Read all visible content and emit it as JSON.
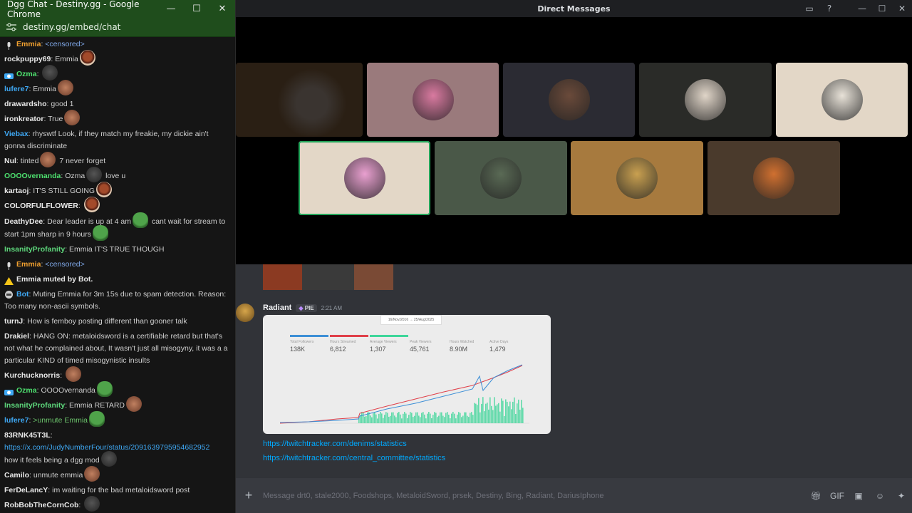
{
  "chat_window": {
    "title": "Dgg Chat - Destiny.gg - Google Chrome",
    "url": "destiny.gg/embed/chat",
    "controls": {
      "minimize": "—",
      "maximize": "☐",
      "close": "✕"
    }
  },
  "chat": [
    {
      "user": "Emmia",
      "style": "orange",
      "badge": "mic",
      "text": "<censored>",
      "censored": true
    },
    {
      "user": "rockpuppy69",
      "text": "Emmia",
      "emote": "face"
    },
    {
      "user": "Ozma",
      "style": "green",
      "badge": "bear",
      "text": "",
      "emote": "dark"
    },
    {
      "user": "lufere7",
      "style": "blue",
      "text": "Emmia",
      "emote": "brown"
    },
    {
      "user": "drawardsho",
      "text": "good 1"
    },
    {
      "user": "ironkreator",
      "text": "True",
      "emote": "brown"
    },
    {
      "user": "Viebax",
      "style": "blue",
      "text": "rhyswtf Look, if they match my freakie, my dickie ain't gonna discriminate",
      "wrap": true
    },
    {
      "user": "Nul",
      "text": "tinted",
      "emote": "brown",
      "text2": "7 never forget"
    },
    {
      "user": "OOOOvernanda",
      "style": "green",
      "text": "Ozma",
      "emote": "dark",
      "text2": "love u"
    },
    {
      "user": "kartaoj",
      "text": "IT'S STILL GOING",
      "emote": "face"
    },
    {
      "user": "COLORFULFLOWER",
      "text": "",
      "emote": "face"
    },
    {
      "user": "DeathyDee",
      "text": "Dear leader is up at 4 am",
      "emote": "pepe",
      "text2": "cant wait for stream to start 1pm sharp in 9 hours",
      "emote2": "pepe",
      "wrap": true
    },
    {
      "user": "InsanityProfanity",
      "style": "lime",
      "text": "Emmia IT'S TRUE THOUGH"
    },
    {
      "user": "Emmia",
      "style": "orange",
      "badge": "mic",
      "text": "<censored>",
      "censored": true
    },
    {
      "user": "",
      "badge": "warn",
      "text": "Emmia muted by Bot.",
      "bold": true
    },
    {
      "user": "Bot",
      "style": "blue",
      "badge": "bot",
      "text": "Muting Emmia for 3m 15s due to spam detection. Reason: Too many non-ascii symbols.",
      "wrap": true
    },
    {
      "user": "turnJ",
      "text": "How is femboy posting different than gooner talk"
    },
    {
      "user": "Drakiel",
      "text": "HANG ON: metaloidsword is a certifiable retard but that's not what he complained about, It wasn't just all misogyny, it was a a particular KIND of timed misogynistic insults",
      "wrap": true
    },
    {
      "user": "Kurchucknorris",
      "text": "",
      "emote": "brown"
    },
    {
      "user": "Ozma",
      "style": "green",
      "badge": "bear",
      "text": "OOOOvernanda",
      "emote": "pepe"
    },
    {
      "user": "InsanityProfanity",
      "style": "lime",
      "text": "Emmia RETARD",
      "emote": "brown"
    },
    {
      "user": "lufere7",
      "style": "blue",
      "text": ">unmute Emmia",
      "greentext": true,
      "emote": "pepe"
    },
    {
      "user": "83RNK45T3L",
      "text": "",
      "link": "https://x.com/JudyNumberFour/status/2091639795954682952",
      "text2": "how it feels being a dgg mod",
      "emote2": "dark",
      "wrap": true
    },
    {
      "user": "Camilo",
      "text": "unmute emmia",
      "emote": "brown"
    },
    {
      "user": "FerDeLancY",
      "text": "im waiting for the bad metaloidsword post"
    },
    {
      "user": "RobBobTheCornCob",
      "text": "",
      "emote": "dark"
    }
  ],
  "discord": {
    "title": "Direct Messages",
    "call_tiles": [
      {
        "kind": "video",
        "bg": "#2a1f14"
      },
      {
        "kind": "avatar",
        "bg": "#9a7a7c",
        "av": "#d97aa0"
      },
      {
        "kind": "avatar",
        "bg": "#2b2b33",
        "av": "#6a4a3a"
      },
      {
        "kind": "avatar",
        "bg": "#2a2b28",
        "av": "#e0d5c8"
      },
      {
        "kind": "avatar",
        "bg": "#e3d7c7",
        "av": "#e8e2d8"
      },
      {
        "kind": "avatar",
        "bg": "#e3d7c7",
        "av": "#e9a0d0",
        "speaking": true
      },
      {
        "kind": "avatar",
        "bg": "#4a5848",
        "av": "#5a6a55"
      },
      {
        "kind": "avatar",
        "bg": "#a77a3e",
        "av": "#c9a050"
      },
      {
        "kind": "avatar",
        "bg": "#4a3a2c",
        "av": "#d07030"
      }
    ],
    "message": {
      "author": "Radiant",
      "tag": "PIE",
      "time": "2:21 AM",
      "links": [
        "https://twitchtracker.com/denims/statistics",
        "https://twitchtracker.com/central_committee/statistics"
      ]
    },
    "embed_stats": {
      "daterange": "16/Nov/2016 → 25/Aug/2025",
      "items": [
        {
          "label": "Total Followers",
          "value": "138K",
          "color": "#3d8fd6"
        },
        {
          "label": "Hours Streamed",
          "value": "6,812",
          "color": "#e0404a"
        },
        {
          "label": "Average Viewers",
          "value": "1,307",
          "color": "#3fd69a"
        },
        {
          "label": "Peak Viewers",
          "value": "45,761",
          "color": "#ececec"
        },
        {
          "label": "Hours Watched",
          "value": "8.90M",
          "color": "#ececec"
        },
        {
          "label": "Active Days",
          "value": "1,479",
          "color": "#ececec"
        }
      ]
    },
    "composer": {
      "placeholder": "Message drt0, stale2000, Foodshops, MetaloidSword, prsek, Destiny, Bing, Radiant, DariusIphone"
    }
  }
}
